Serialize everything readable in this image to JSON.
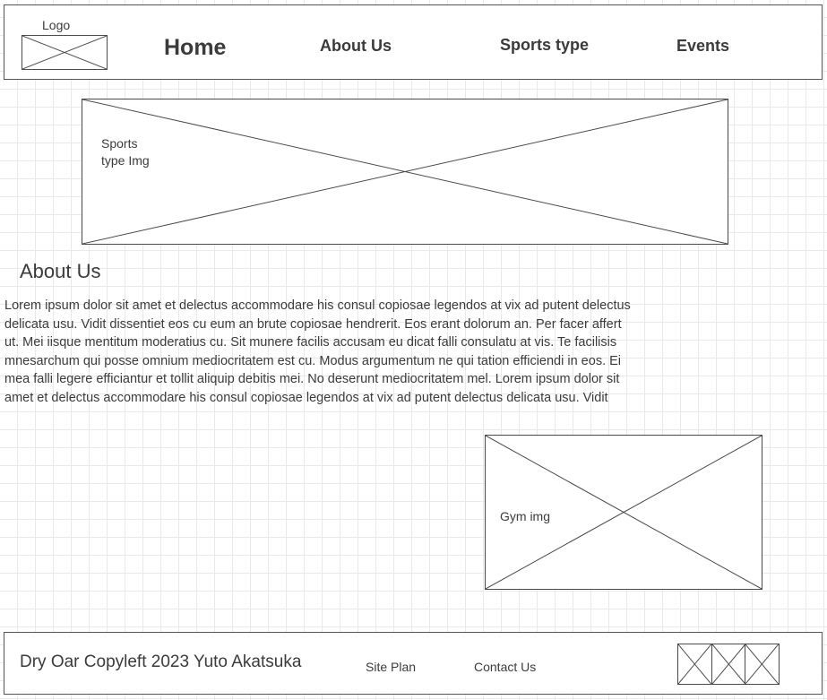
{
  "header": {
    "logo": {
      "label": "Logo",
      "icon": "image-placeholder-icon"
    },
    "nav": [
      {
        "label": "Home"
      },
      {
        "label": "About Us"
      },
      {
        "label": "Sports type"
      },
      {
        "label": "Events"
      }
    ]
  },
  "hero": {
    "image_placeholder": {
      "label": "Sports\ntype Img",
      "icon": "image-placeholder-icon"
    }
  },
  "about": {
    "heading": "About Us",
    "body": "Lorem ipsum dolor sit amet et delectus accommodare his consul copiosae legendos at vix ad putent delectus delicata usu. Vidit dissentiet eos cu eum an brute copiosae hendrerit. Eos erant dolorum an. Per facer affert ut. Mei iisque mentitum moderatius cu. Sit munere facilis accusam eu dicat falli consulatu at vis. Te facilisis mnesarchum qui posse omnium mediocritatem est cu. Modus argumentum ne qui tation efficiendi in eos. Ei mea falli legere efficiantur et tollit aliquip debitis mei. No deserunt mediocritatem mel. Lorem ipsum dolor sit amet et delectus accommodare his consul copiosae legendos at vix ad putent delectus delicata usu. Vidit"
  },
  "gym": {
    "image_placeholder": {
      "label": "Gym img",
      "icon": "image-placeholder-icon"
    }
  },
  "footer": {
    "copyright": "Dry Oar Copyleft 2023 Yuto Akatsuka",
    "links": [
      {
        "label": "Site Plan"
      },
      {
        "label": "Contact Us"
      }
    ],
    "social_icons": [
      {
        "icon": "social-placeholder-icon-1"
      },
      {
        "icon": "social-placeholder-icon-2"
      },
      {
        "icon": "social-placeholder-icon-3"
      }
    ]
  },
  "colors": {
    "ink": "#3b3b3b",
    "stroke": "#4a4a4a",
    "grid": "#e9e9e9",
    "background": "#ffffff"
  }
}
